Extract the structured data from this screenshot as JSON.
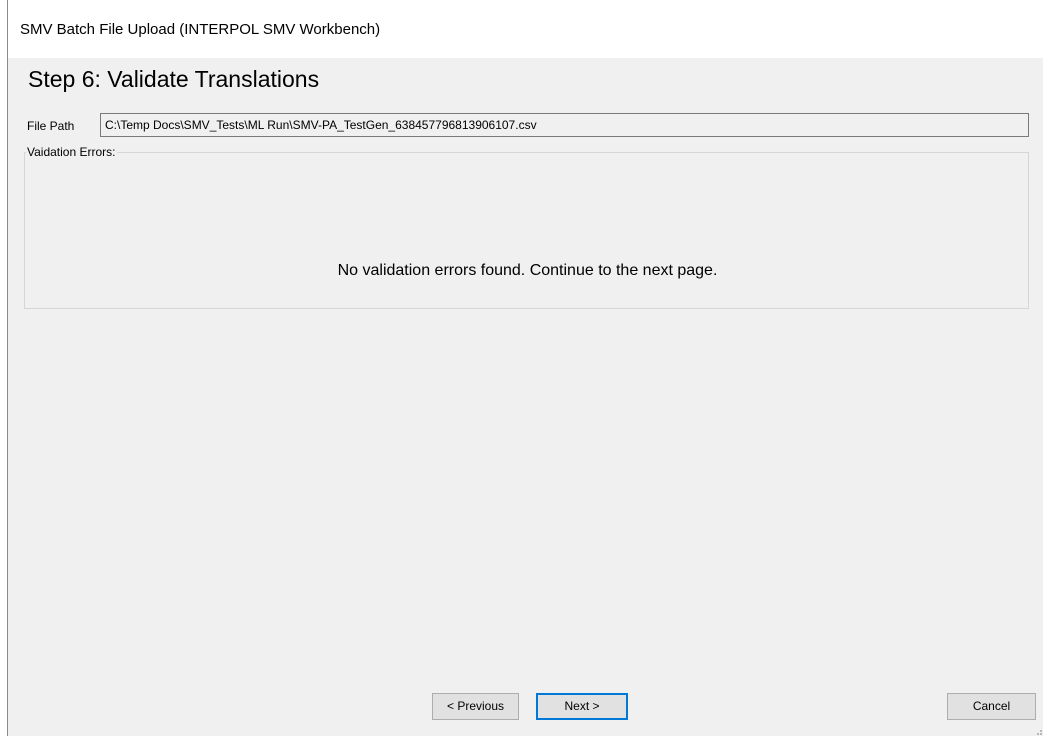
{
  "window": {
    "title": "SMV Batch File Upload (INTERPOL SMV Workbench)"
  },
  "wizard": {
    "step_heading": "Step 6: Validate Translations",
    "file_path_label": "File Path",
    "file_path_value": "C:\\Temp Docs\\SMV_Tests\\ML Run\\SMV-PA_TestGen_638457796813906107.csv",
    "validation_group_label": "Vaidation Errors:",
    "validation_message": "No validation errors found.  Continue to the next page."
  },
  "buttons": {
    "previous_label": "< Previous",
    "next_label": "Next >",
    "cancel_label": "Cancel"
  },
  "colors": {
    "window_background": "#f0f0f0",
    "titlebar_background": "#ffffff",
    "default_button_border": "#0078d7"
  },
  "icons": {
    "resize_grip": "size-grip-icon"
  }
}
